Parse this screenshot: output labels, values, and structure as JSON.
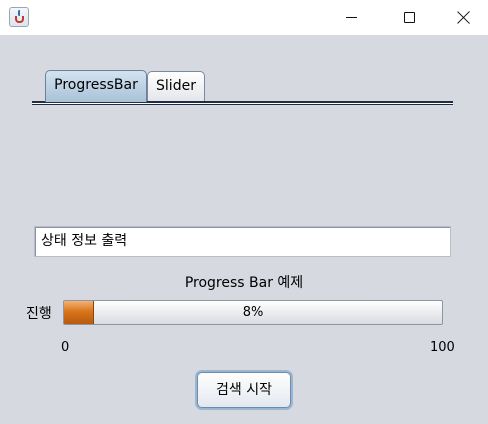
{
  "window": {
    "title": "",
    "app_icon": "java-cup-icon",
    "controls": [
      "minimize-icon",
      "maximize-icon",
      "close-icon"
    ]
  },
  "tabs": [
    {
      "label": "ProgressBar",
      "selected": true
    },
    {
      "label": "Slider",
      "selected": false
    }
  ],
  "status": {
    "value": "상태 정보 출력"
  },
  "progress": {
    "title": "Progress Bar 예제",
    "label": "진행",
    "value": 8,
    "value_text": "8%",
    "min": "0",
    "max": "100",
    "fill_color": "#d9751a"
  },
  "actions": {
    "start_search": "검색 시작"
  }
}
